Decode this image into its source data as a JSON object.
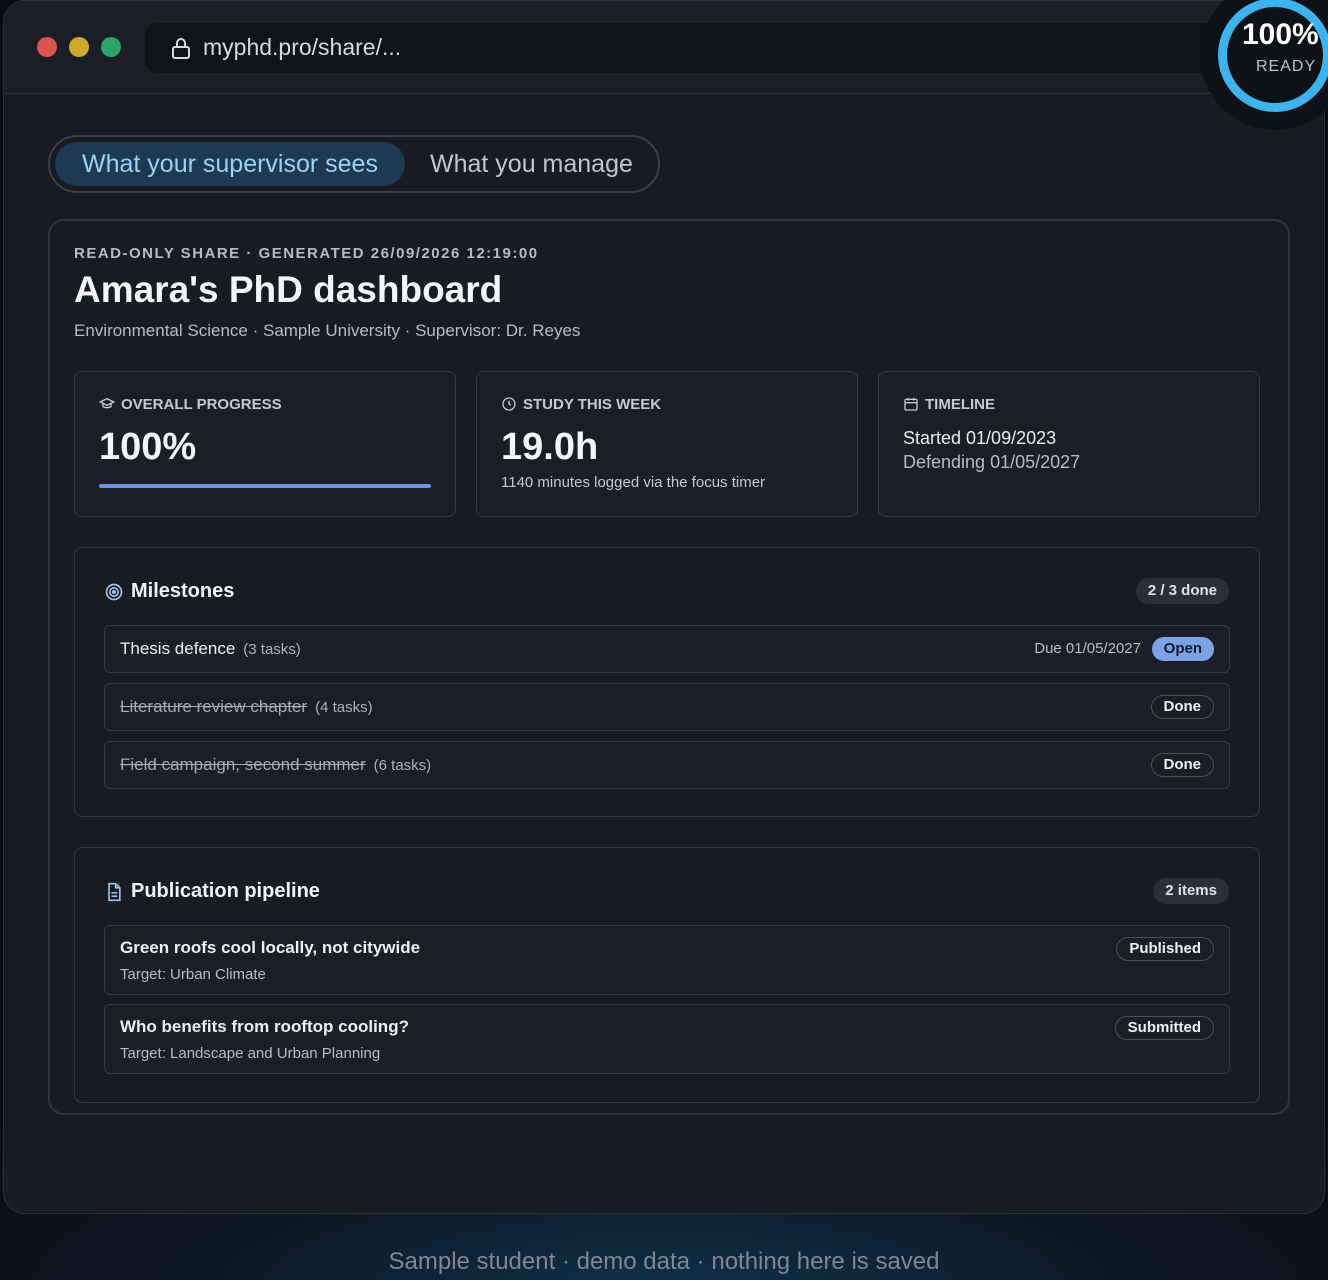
{
  "browser": {
    "url": "myphd.pro/share/..."
  },
  "ready_badge": {
    "percent": "100%",
    "label": "READY"
  },
  "view_toggle": {
    "active": "What your supervisor sees",
    "inactive": "What you manage"
  },
  "dashboard": {
    "meta": "READ-ONLY SHARE · GENERATED 26/09/2026 12:19:00",
    "title": "Amara's PhD dashboard",
    "subtitle": "Environmental Science · Sample University · Supervisor: Dr. Reyes"
  },
  "stats": {
    "progress": {
      "label": "OVERALL PROGRESS",
      "value": "100%",
      "fraction": 1.0
    },
    "study": {
      "label": "STUDY THIS WEEK",
      "value": "19.0h",
      "note": "1140 minutes logged via the focus timer"
    },
    "timeline": {
      "label": "TIMELINE",
      "started": "Started 01/09/2023",
      "defending": "Defending 01/05/2027"
    }
  },
  "milestones": {
    "title": "Milestones",
    "count": "2 / 3 done",
    "items": [
      {
        "name": "Thesis defence",
        "tasks": "(3 tasks)",
        "due": "Due 01/05/2027",
        "status": "Open"
      },
      {
        "name": "Literature review chapter",
        "tasks": "(4 tasks)",
        "status": "Done"
      },
      {
        "name": "Field campaign, second summer",
        "tasks": "(6 tasks)",
        "status": "Done"
      }
    ]
  },
  "publications": {
    "title": "Publication pipeline",
    "count": "2 items",
    "items": [
      {
        "title": "Green roofs cool locally, not citywide",
        "target": "Target: Urban Climate",
        "status": "Published"
      },
      {
        "title": "Who benefits from rooftop cooling?",
        "target": "Target: Landscape and Urban Planning",
        "status": "Submitted"
      }
    ]
  },
  "footer": "Sample student · demo data · nothing here is saved",
  "colors": {
    "accent": "#3ab3ef",
    "progress_fill": "#6f93d6",
    "open_pill": "#7aa3e6",
    "active_tab": "#1d3a52"
  }
}
